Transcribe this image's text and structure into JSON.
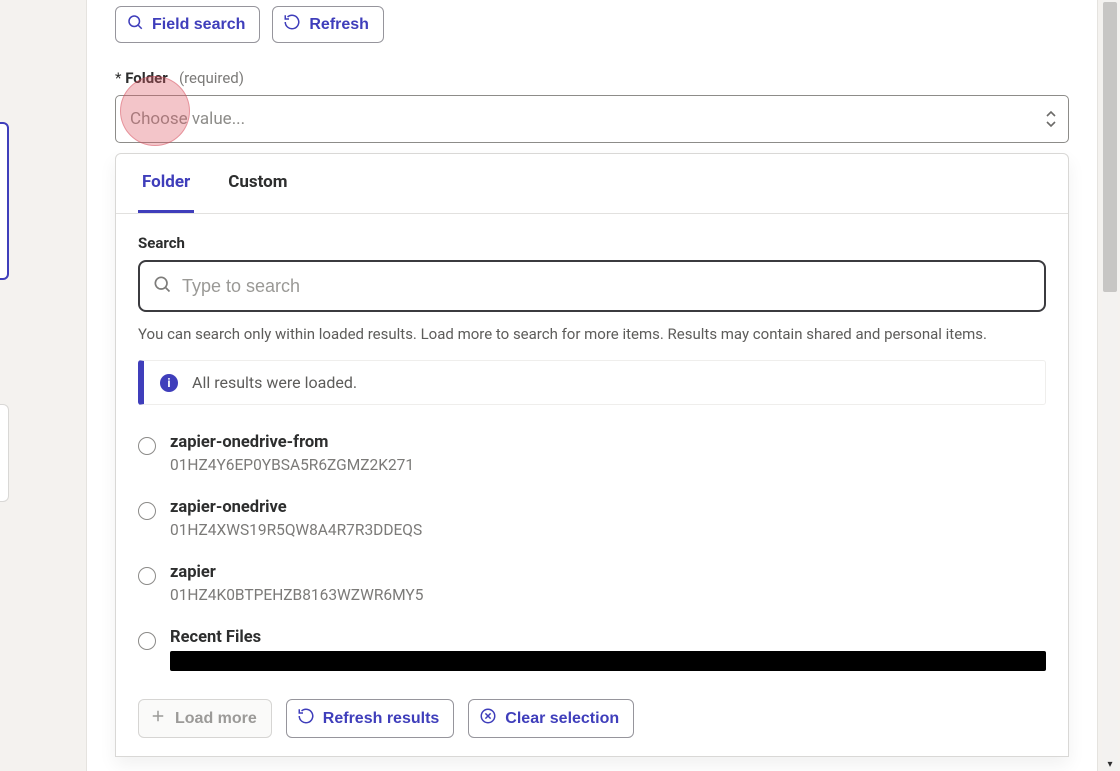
{
  "toolbar": {
    "field_search": "Field search",
    "refresh": "Refresh"
  },
  "field": {
    "asterisk": "*",
    "label": "Folder",
    "required_hint": "(required)",
    "placeholder": "Choose value..."
  },
  "dropdown": {
    "tabs": {
      "folder": "Folder",
      "custom": "Custom"
    },
    "search_label": "Search",
    "search_placeholder": "Type to search",
    "hint": "You can search only within loaded results. Load more to search for more items. Results may contain shared and personal items.",
    "info": "All results were loaded.",
    "options": [
      {
        "title": "zapier-onedrive-from",
        "sub": "01HZ4Y6EP0YBSA5R6ZGMZ2K271"
      },
      {
        "title": "zapier-onedrive",
        "sub": "01HZ4XWS19R5QW8A4R7R3DDEQS"
      },
      {
        "title": "zapier",
        "sub": "01HZ4K0BTPEHZB8163WZWR6MY5"
      },
      {
        "title": "Recent Files",
        "sub": ""
      }
    ],
    "footer": {
      "load_more": "Load more",
      "refresh_results": "Refresh results",
      "clear_selection": "Clear selection"
    }
  }
}
